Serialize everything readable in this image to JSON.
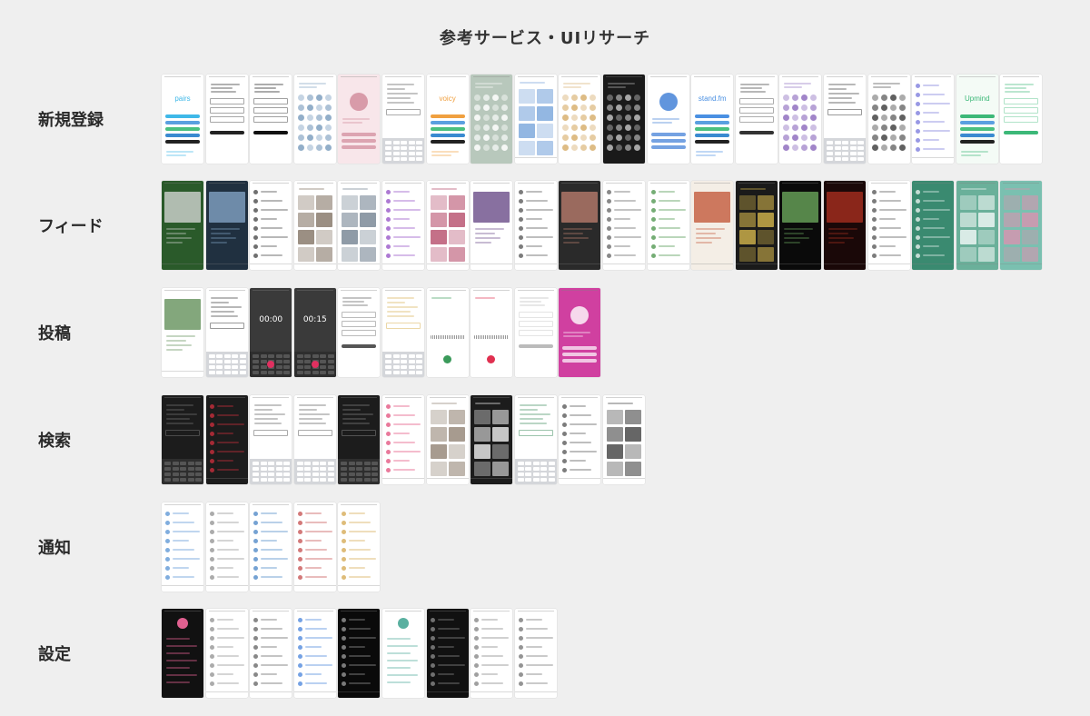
{
  "title": "参考サービス・UIリサーチ",
  "rows": [
    {
      "label": "新規登録",
      "screens": [
        {
          "bg": "#ffffff",
          "fg": "#3fb8e8",
          "kind": "login",
          "text": "pairs"
        },
        {
          "bg": "#ffffff",
          "fg": "#222222",
          "kind": "form"
        },
        {
          "bg": "#ffffff",
          "fg": "#111111",
          "kind": "form"
        },
        {
          "bg": "#ffffff",
          "fg": "#7fa0c0",
          "kind": "avatars"
        },
        {
          "bg": "#f8e6ea",
          "fg": "#d08898",
          "kind": "hero"
        },
        {
          "bg": "#ffffff",
          "fg": "#555555",
          "kind": "keyboard"
        },
        {
          "bg": "#ffffff",
          "fg": "#f0a040",
          "kind": "login",
          "text": "voicy"
        },
        {
          "bg": "#b8c8bc",
          "fg": "#ffffff",
          "kind": "avatars"
        },
        {
          "bg": "#ffffff",
          "fg": "#6f9fd8",
          "kind": "grid"
        },
        {
          "bg": "#ffffff",
          "fg": "#d8b070",
          "kind": "avatars"
        },
        {
          "bg": "#1a1a1a",
          "fg": "#c0c0c0",
          "kind": "avatars"
        },
        {
          "bg": "#ffffff",
          "fg": "#3a7bd5",
          "kind": "hero"
        },
        {
          "bg": "#ffffff",
          "fg": "#4a90e2",
          "kind": "login",
          "text": "stand.fm"
        },
        {
          "bg": "#ffffff",
          "fg": "#333333",
          "kind": "form"
        },
        {
          "bg": "#ffffff",
          "fg": "#9070c0",
          "kind": "avatars"
        },
        {
          "bg": "#ffffff",
          "fg": "#333333",
          "kind": "keyboard"
        },
        {
          "bg": "#ffffff",
          "fg": "#444444",
          "kind": "avatars"
        },
        {
          "bg": "#ffffff",
          "fg": "#6c6cd8",
          "kind": "list"
        },
        {
          "bg": "#f4fbf6",
          "fg": "#3cb878",
          "kind": "login",
          "text": "Upmind"
        },
        {
          "bg": "#ffffff",
          "fg": "#3cb878",
          "kind": "form"
        }
      ]
    },
    {
      "label": "フィード",
      "screens": [
        {
          "bg": "#2a5a2a",
          "fg": "#dddddd",
          "kind": "media"
        },
        {
          "bg": "#203040",
          "fg": "#88aacc",
          "kind": "media"
        },
        {
          "bg": "#ffffff",
          "fg": "#333333",
          "kind": "list"
        },
        {
          "bg": "#ffffff",
          "fg": "#7a6a5a",
          "kind": "grid"
        },
        {
          "bg": "#ffffff",
          "fg": "#6a7a8a",
          "kind": "grid"
        },
        {
          "bg": "#ffffff",
          "fg": "#8a40c0",
          "kind": "list"
        },
        {
          "bg": "#ffffff",
          "fg": "#b04060",
          "kind": "grid"
        },
        {
          "bg": "#ffffff",
          "fg": "#604080",
          "kind": "media"
        },
        {
          "bg": "#ffffff",
          "fg": "#444444",
          "kind": "list"
        },
        {
          "bg": "#2a2a2a",
          "fg": "#c08070",
          "kind": "media"
        },
        {
          "bg": "#ffffff",
          "fg": "#555555",
          "kind": "list"
        },
        {
          "bg": "#ffffff",
          "fg": "#3a8a3a",
          "kind": "list"
        },
        {
          "bg": "#f4eee6",
          "fg": "#c05030",
          "kind": "media"
        },
        {
          "bg": "#1a1a1a",
          "fg": "#e0c050",
          "kind": "grid"
        },
        {
          "bg": "#0a0a0a",
          "fg": "#70b060",
          "kind": "media"
        },
        {
          "bg": "#1a0808",
          "fg": "#b03020",
          "kind": "media"
        },
        {
          "bg": "#ffffff",
          "fg": "#444444",
          "kind": "list"
        },
        {
          "bg": "#3a8a70",
          "fg": "#ffffff",
          "kind": "list"
        },
        {
          "bg": "#6ab09a",
          "fg": "#ffffff",
          "kind": "grid"
        },
        {
          "bg": "#7ac0b0",
          "fg": "#e090b0",
          "kind": "grid"
        }
      ]
    },
    {
      "label": "投稿",
      "screens": [
        {
          "bg": "#ffffff",
          "fg": "#5a8a50",
          "kind": "media"
        },
        {
          "bg": "#ffffff",
          "fg": "#333333",
          "kind": "keyboard"
        },
        {
          "bg": "#3a3a3a",
          "fg": "#ffffff",
          "kind": "timer",
          "text": "00:00"
        },
        {
          "bg": "#3a3a3a",
          "fg": "#ffffff",
          "kind": "timer",
          "text": "00:15"
        },
        {
          "bg": "#ffffff",
          "fg": "#555555",
          "kind": "form"
        },
        {
          "bg": "#ffffff",
          "fg": "#d8b050",
          "kind": "keyboard"
        },
        {
          "bg": "#ffffff",
          "fg": "#3a9a5a",
          "kind": "record"
        },
        {
          "bg": "#ffffff",
          "fg": "#e03050",
          "kind": "record"
        },
        {
          "bg": "#ffffff",
          "fg": "#bbbbbb",
          "kind": "form"
        },
        {
          "bg": "#d040a0",
          "fg": "#ffffff",
          "kind": "hero"
        }
      ]
    },
    {
      "label": "検索",
      "screens": [
        {
          "bg": "#1c1c1c",
          "fg": "#777777",
          "kind": "keyboard"
        },
        {
          "bg": "#1c1c1c",
          "fg": "#e03040",
          "kind": "list"
        },
        {
          "bg": "#ffffff",
          "fg": "#555555",
          "kind": "keyboard"
        },
        {
          "bg": "#ffffff",
          "fg": "#555555",
          "kind": "keyboard"
        },
        {
          "bg": "#1c1c1c",
          "fg": "#888888",
          "kind": "keyboard"
        },
        {
          "bg": "#ffffff",
          "fg": "#e04070",
          "kind": "list"
        },
        {
          "bg": "#ffffff",
          "fg": "#8a7a6a",
          "kind": "grid"
        },
        {
          "bg": "#1c1c1c",
          "fg": "#ffffff",
          "kind": "grid"
        },
        {
          "bg": "#ffffff",
          "fg": "#3a8a5a",
          "kind": "keyboard"
        },
        {
          "bg": "#ffffff",
          "fg": "#444444",
          "kind": "list"
        },
        {
          "bg": "#ffffff",
          "fg": "#333333",
          "kind": "grid"
        }
      ]
    },
    {
      "label": "通知",
      "screens": [
        {
          "bg": "#ffffff",
          "fg": "#4a8ad0",
          "kind": "list"
        },
        {
          "bg": "#ffffff",
          "fg": "#888888",
          "kind": "list"
        },
        {
          "bg": "#ffffff",
          "fg": "#3a7ac0",
          "kind": "list"
        },
        {
          "bg": "#ffffff",
          "fg": "#c04040",
          "kind": "list"
        },
        {
          "bg": "#ffffff",
          "fg": "#d0a040",
          "kind": "list"
        }
      ]
    },
    {
      "label": "設定",
      "screens": [
        {
          "bg": "#111111",
          "fg": "#e06090",
          "kind": "profile"
        },
        {
          "bg": "#ffffff",
          "fg": "#888888",
          "kind": "list"
        },
        {
          "bg": "#ffffff",
          "fg": "#555555",
          "kind": "list"
        },
        {
          "bg": "#ffffff",
          "fg": "#3a7ad8",
          "kind": "list"
        },
        {
          "bg": "#0a0a0a",
          "fg": "#aaaaaa",
          "kind": "list"
        },
        {
          "bg": "#ffffff",
          "fg": "#5ab0a0",
          "kind": "profile"
        },
        {
          "bg": "#111111",
          "fg": "#999999",
          "kind": "list"
        },
        {
          "bg": "#ffffff",
          "fg": "#777777",
          "kind": "list"
        },
        {
          "bg": "#ffffff",
          "fg": "#666666",
          "kind": "list"
        }
      ]
    }
  ]
}
